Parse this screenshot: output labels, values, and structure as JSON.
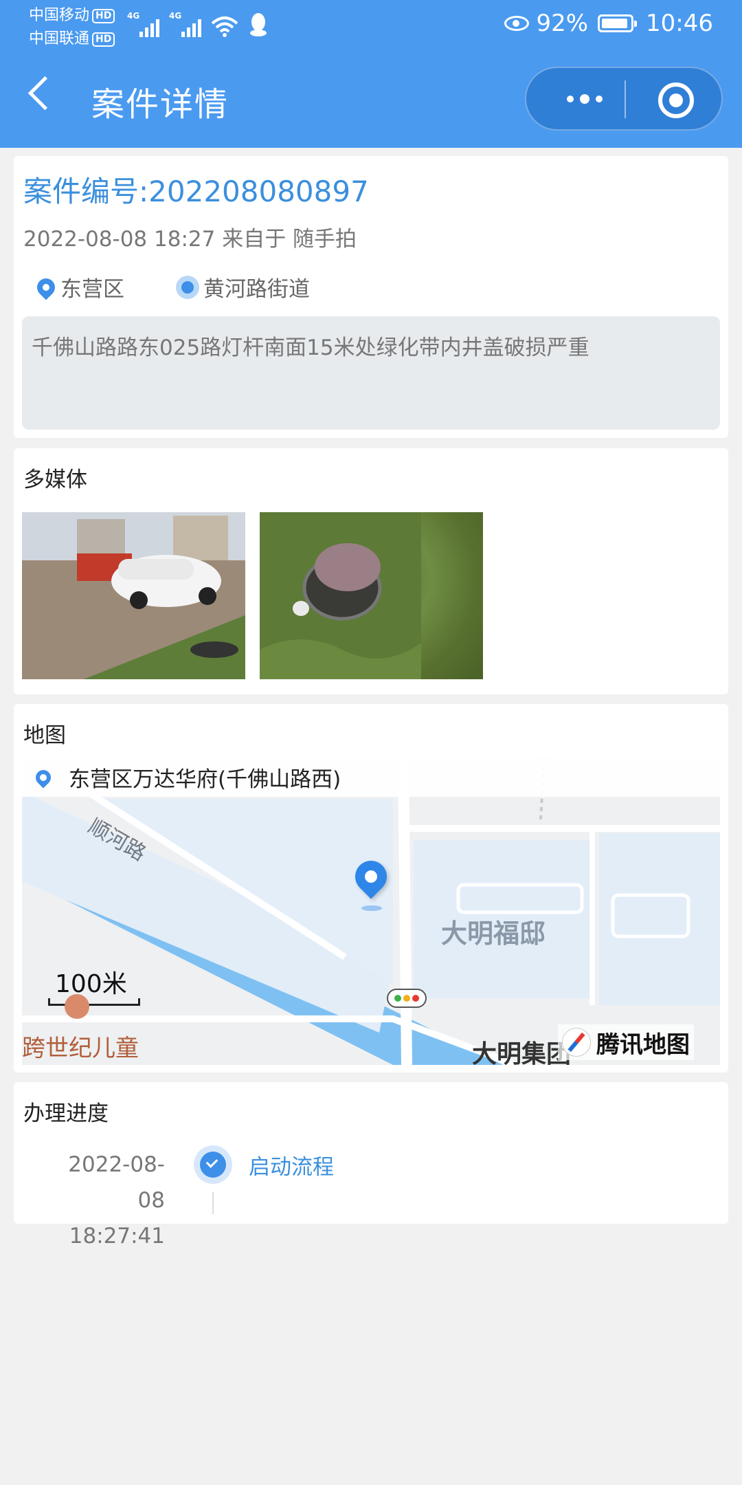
{
  "status_bar": {
    "carrier1": "中国移动",
    "carrier2": "中国联通",
    "hd": "HD",
    "net1": "4G",
    "net2": "4G",
    "battery": "92%",
    "time": "10:46"
  },
  "nav": {
    "title": "案件详情",
    "back_icon": "chevron-left-icon",
    "more_icon": "more-dots-icon",
    "record_icon": "record-circle-icon"
  },
  "case": {
    "id_label": "案件编号:202208080897",
    "meta": "2022-08-08 18:27 来自于 随手拍",
    "district": "东营区",
    "street": "黄河路街道",
    "description": "千佛山路路东025路灯杆南面15米处绿化带内井盖破损严重"
  },
  "media": {
    "title": "多媒体",
    "photos": [
      "photo-cars-street",
      "photo-manhole-cover"
    ]
  },
  "map": {
    "title": "地图",
    "address": "东营区万达华府(千佛山路西)",
    "road_label": "顺河路",
    "area_label": "大明福邸",
    "scale": "100米",
    "poi_label": "跨世纪儿童",
    "poi2_label": "大明集团",
    "brand": "腾讯地图"
  },
  "progress": {
    "title": "办理进度",
    "items": [
      {
        "date": "2022-08-08",
        "time": "18:27:41",
        "label": "启动流程"
      }
    ]
  },
  "colors": {
    "header": "#4a9af0",
    "accent": "#3b8fdd",
    "background": "#f1f1f2"
  }
}
